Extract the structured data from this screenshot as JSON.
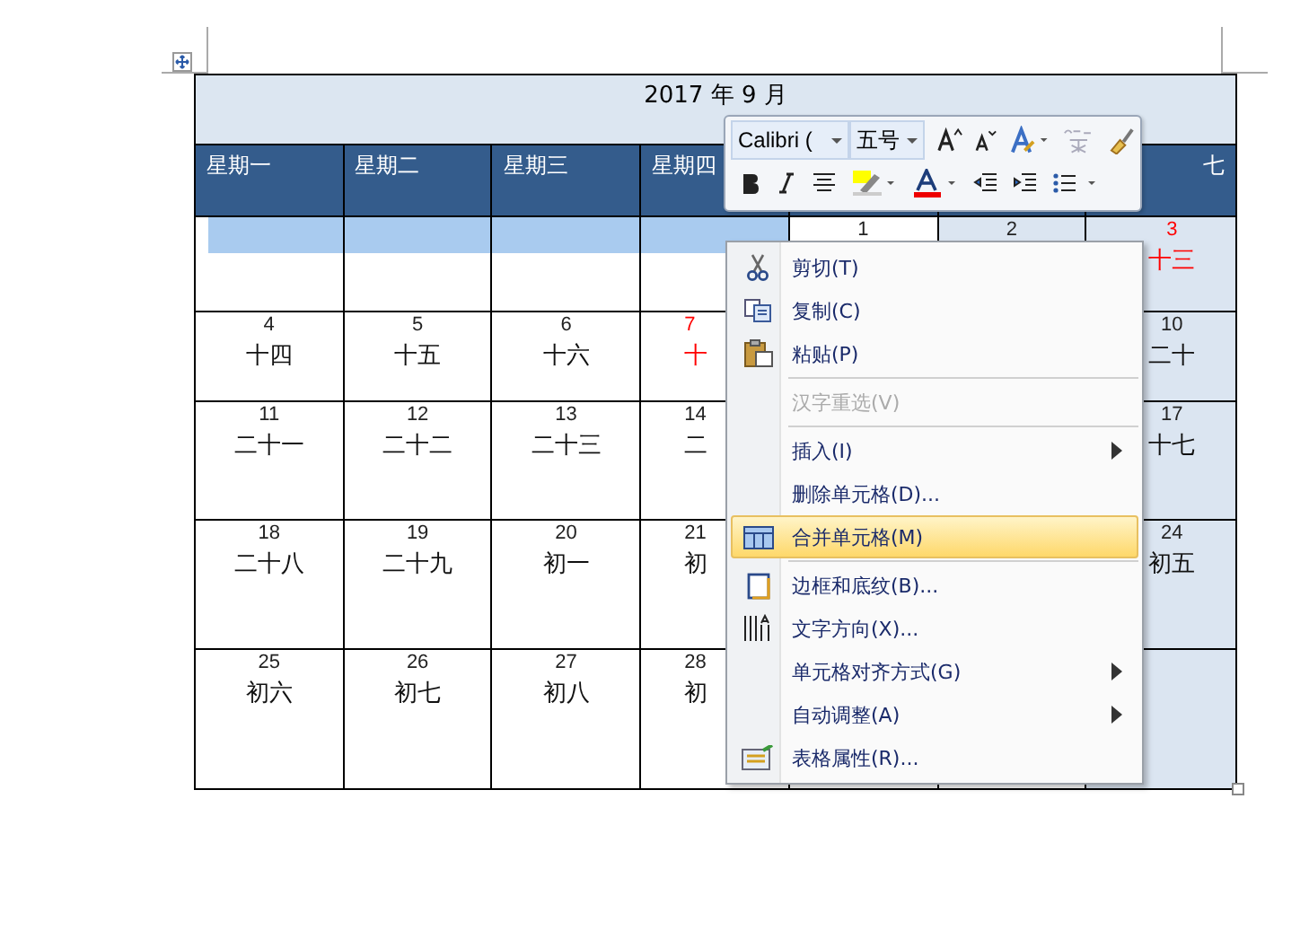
{
  "calendar": {
    "title": "2017 年 9 月",
    "headers": [
      "星期一",
      "星期二",
      "星期三",
      "星期四"
    ],
    "headers_right": [
      "七"
    ],
    "rows": [
      [
        {
          "selected": true,
          "kind": "band"
        },
        {
          "selected": true,
          "kind": "band"
        },
        {
          "selected": true,
          "kind": "band"
        },
        {
          "selected": true,
          "kind": "band"
        },
        {
          "day": "1",
          "red": false,
          "selected": false
        },
        {
          "day": "2",
          "red": false,
          "selected": true,
          "kind": "full"
        },
        {
          "day": "3",
          "lunar": "十三",
          "red": true,
          "selected": true,
          "kind": "full"
        }
      ],
      [
        {
          "day": "4",
          "lunar": "十四",
          "red": false
        },
        {
          "day": "5",
          "lunar": "十五",
          "red": false
        },
        {
          "day": "6",
          "lunar": "十六",
          "red": false
        },
        {
          "day": "7",
          "lunar": "十",
          "red": true
        },
        null,
        null,
        {
          "day": "10",
          "lunar": "二十",
          "red": false,
          "selected": true,
          "kind": "full"
        }
      ],
      [
        {
          "day": "11",
          "lunar": "二十一",
          "red": false
        },
        {
          "day": "12",
          "lunar": "二十二",
          "red": false
        },
        {
          "day": "13",
          "lunar": "二十三",
          "red": false
        },
        {
          "day": "14",
          "lunar": "二",
          "red": false
        },
        null,
        null,
        {
          "day": "17",
          "lunar": "十七",
          "red": false,
          "selected": true,
          "kind": "full"
        }
      ],
      [
        {
          "day": "18",
          "lunar": "二十八",
          "red": false
        },
        {
          "day": "19",
          "lunar": "二十九",
          "red": false
        },
        {
          "day": "20",
          "lunar": "初一",
          "red": false
        },
        {
          "day": "21",
          "lunar": "初",
          "red": false
        },
        null,
        null,
        {
          "day": "24",
          "lunar": "初五",
          "red": false,
          "selected": true,
          "kind": "full"
        }
      ],
      [
        {
          "day": "25",
          "lunar": "初六",
          "red": false
        },
        {
          "day": "26",
          "lunar": "初七",
          "red": false
        },
        {
          "day": "27",
          "lunar": "初八",
          "red": false
        },
        {
          "day": "28",
          "lunar": "初",
          "red": false
        },
        null,
        null,
        {
          "selected": true,
          "kind": "full"
        }
      ]
    ]
  },
  "mini_toolbar": {
    "font": "Calibri (",
    "size": "五号"
  },
  "context_menu": [
    {
      "kind": "item",
      "label": "剪切(T)",
      "disabled": false,
      "selected": false
    },
    {
      "kind": "item",
      "label": "复制(C)",
      "disabled": false,
      "selected": false
    },
    {
      "kind": "item",
      "label": "粘贴(P)",
      "disabled": false,
      "selected": false
    },
    {
      "kind": "separator"
    },
    {
      "kind": "item",
      "label": "汉字重选(V)",
      "disabled": true,
      "selected": false
    },
    {
      "kind": "separator"
    },
    {
      "kind": "item",
      "label": "插入(I)",
      "disabled": false,
      "submenu": true,
      "selected": false
    },
    {
      "kind": "item",
      "label": "删除单元格(D)...",
      "disabled": false,
      "selected": false
    },
    {
      "kind": "item",
      "label": "合并单元格(M)",
      "disabled": false,
      "selected": true
    },
    {
      "kind": "separator"
    },
    {
      "kind": "item",
      "label": "边框和底纹(B)...",
      "disabled": false,
      "selected": false
    },
    {
      "kind": "item",
      "label": "文字方向(X)...",
      "disabled": false,
      "selected": false
    },
    {
      "kind": "item",
      "label": "单元格对齐方式(G)",
      "disabled": false,
      "submenu": true,
      "selected": false
    },
    {
      "kind": "item",
      "label": "自动调整(A)",
      "disabled": false,
      "submenu": true,
      "selected": false
    },
    {
      "kind": "item",
      "label": "表格属性(R)...",
      "disabled": false,
      "selected": false
    }
  ]
}
